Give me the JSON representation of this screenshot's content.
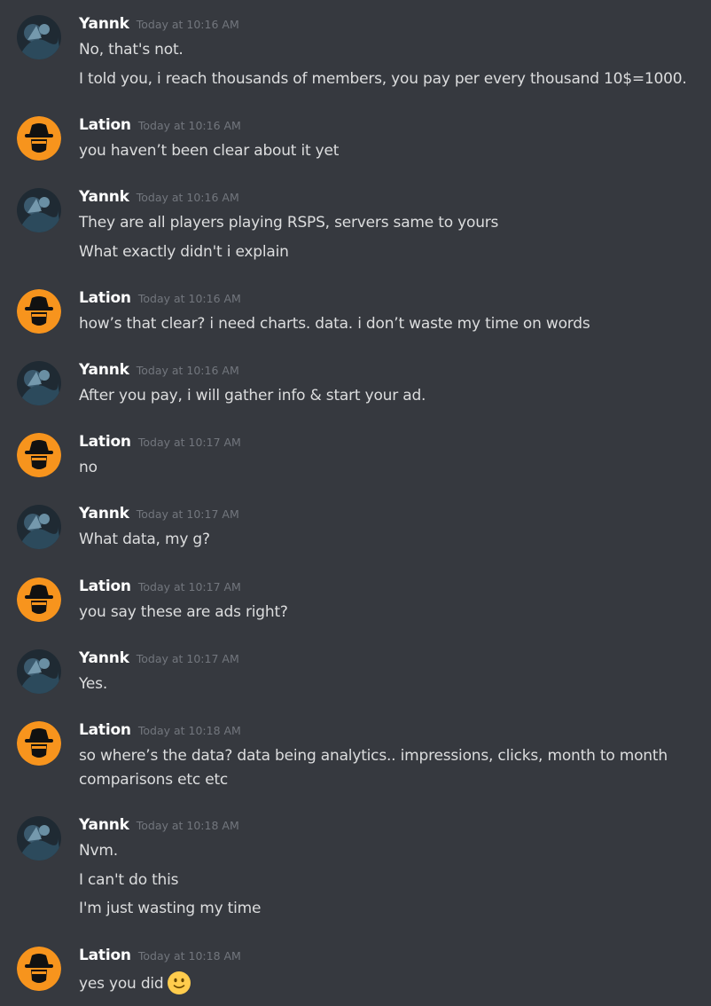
{
  "users": {
    "yannk": {
      "name": "Yannk",
      "avatar_icon": "user-avatar-dark-photo"
    },
    "lation": {
      "name": "Lation",
      "avatar_icon": "hacker-hat-avatar",
      "color": "#f7941d"
    }
  },
  "messages": [
    {
      "author": "Yannk",
      "time": "Today at 10:16 AM",
      "lines": [
        "No, that's not.",
        "I told you, i reach thousands of members, you pay per every thousand 10$=1000."
      ]
    },
    {
      "author": "Lation",
      "time": "Today at 10:16 AM",
      "lines": [
        "you haven’t been clear about it yet"
      ]
    },
    {
      "author": "Yannk",
      "time": "Today at 10:16 AM",
      "lines": [
        "They are all players playing RSPS, servers same to yours",
        "What exactly didn't i explain"
      ]
    },
    {
      "author": "Lation",
      "time": "Today at 10:16 AM",
      "lines": [
        "how’s that clear? i need charts. data. i don’t waste my time on words"
      ]
    },
    {
      "author": "Yannk",
      "time": "Today at 10:16 AM",
      "lines": [
        "After you pay, i will gather info & start your ad."
      ]
    },
    {
      "author": "Lation",
      "time": "Today at 10:17 AM",
      "lines": [
        "no"
      ]
    },
    {
      "author": "Yannk",
      "time": "Today at 10:17 AM",
      "lines": [
        "What data, my g?"
      ]
    },
    {
      "author": "Lation",
      "time": "Today at 10:17 AM",
      "lines": [
        "you say these are ads right?"
      ]
    },
    {
      "author": "Yannk",
      "time": "Today at 10:17 AM",
      "lines": [
        "Yes."
      ]
    },
    {
      "author": "Lation",
      "time": "Today at 10:18 AM",
      "lines": [
        "so where’s the data? data being analytics.. impressions, clicks, month to month",
        "comparisons etc etc"
      ]
    },
    {
      "author": "Yannk",
      "time": "Today at 10:18 AM",
      "lines": [
        "Nvm.",
        "I can't do this",
        "I'm just wasting my time"
      ]
    },
    {
      "author": "Lation",
      "time": "Today at 10:18 AM",
      "lines": [
        "yes you did"
      ],
      "emoji": "slightly-smiling-face-icon"
    }
  ]
}
